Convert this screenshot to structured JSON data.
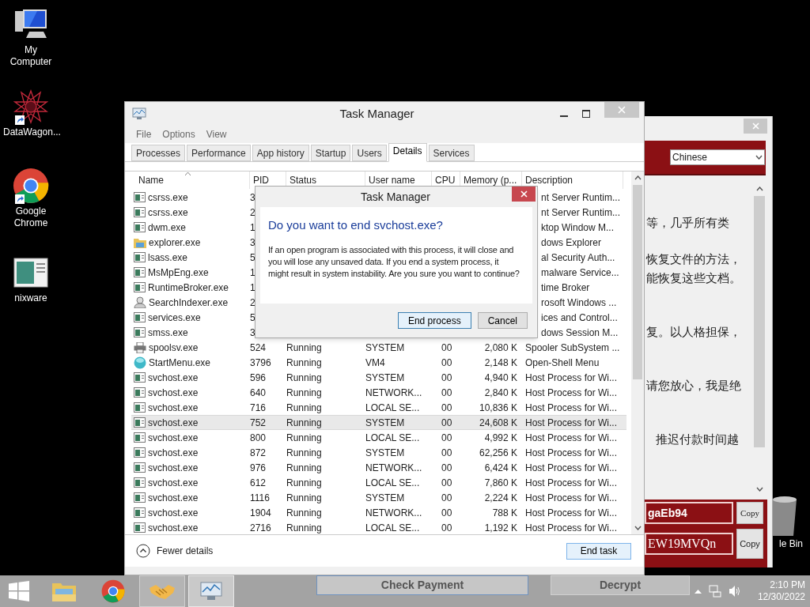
{
  "desktop_icons": [
    {
      "label": "My Computer",
      "kind": "computer",
      "shortcut": false
    },
    {
      "label": "DataWagon...",
      "kind": "star",
      "shortcut": true
    },
    {
      "label": "Google Chrome",
      "kind": "chrome",
      "shortcut": true
    },
    {
      "label": "nixware",
      "kind": "app",
      "shortcut": false
    }
  ],
  "recycle_bin": {
    "label": "le Bin"
  },
  "ransom_window": {
    "language_select": {
      "value": "Chinese"
    },
    "text_lines": [
      {
        "text": "等，几乎所有类",
        "kind": "section"
      },
      {
        "text": "恢复文件的方法，",
        "kind": "paragraph"
      },
      {
        "text": "能恢复这些文档。",
        "kind": "continuation"
      },
      {
        "text": "复。以人格担保，",
        "kind": "section"
      },
      {
        "text": "请您放心，我是绝",
        "kind": "section"
      },
      {
        "text": "推迟付款时间越",
        "kind": "indented"
      }
    ],
    "fields": [
      {
        "value": "gaEb94",
        "button": "Copy",
        "kind": "sans"
      },
      {
        "value": "EW19MVQn",
        "button": "Copy",
        "kind": "serif"
      }
    ],
    "buttons": [
      "Check Payment",
      "Decrypt"
    ]
  },
  "task_manager": {
    "title": "Task Manager",
    "menu": [
      "File",
      "Options",
      "View"
    ],
    "tabs": [
      {
        "label": "Processes",
        "selected": false
      },
      {
        "label": "Performance",
        "selected": false
      },
      {
        "label": "App history",
        "selected": false
      },
      {
        "label": "Startup",
        "selected": false
      },
      {
        "label": "Users",
        "selected": false
      },
      {
        "label": "Details",
        "selected": true
      },
      {
        "label": "Services",
        "selected": false
      }
    ],
    "columns": [
      "Name",
      "PID",
      "Status",
      "User name",
      "CPU",
      "Memory (p...",
      "Description"
    ],
    "rows": [
      {
        "name": "csrss.exe",
        "kind": "app",
        "pid": "3",
        "description": "nt Server Runtim...",
        "selected": false
      },
      {
        "name": "csrss.exe",
        "kind": "app",
        "pid": "2",
        "description": "nt Server Runtim...",
        "selected": false
      },
      {
        "name": "dwm.exe",
        "kind": "app",
        "pid": "1",
        "description": "ktop Window M...",
        "selected": false
      },
      {
        "name": "explorer.exe",
        "kind": "folder",
        "pid": "3",
        "description": "dows Explorer",
        "selected": false
      },
      {
        "name": "lsass.exe",
        "kind": "app",
        "pid": "5",
        "description": "al Security Auth...",
        "selected": false
      },
      {
        "name": "MsMpEng.exe",
        "kind": "app",
        "pid": "1",
        "description": "malware Service...",
        "selected": false
      },
      {
        "name": "RuntimeBroker.exe",
        "kind": "app",
        "pid": "1",
        "description": "time Broker",
        "selected": false
      },
      {
        "name": "SearchIndexer.exe",
        "kind": "user",
        "pid": "2",
        "description": "rosoft Windows ...",
        "selected": false
      },
      {
        "name": "services.exe",
        "kind": "app",
        "pid": "5",
        "description": "ices and Control...",
        "selected": false
      },
      {
        "name": "smss.exe",
        "kind": "app",
        "pid": "3",
        "description": "dows Session M...",
        "selected": false
      },
      {
        "name": "spoolsv.exe",
        "kind": "printer",
        "pid": "524",
        "status": "Running",
        "user": "SYSTEM",
        "cpu": "00",
        "memory": "2,080 K",
        "description": "Spooler SubSystem ...",
        "selected": false
      },
      {
        "name": "StartMenu.exe",
        "kind": "orb",
        "pid": "3796",
        "status": "Running",
        "user": "VM4",
        "cpu": "00",
        "memory": "2,148 K",
        "description": "Open-Shell Menu",
        "selected": false
      },
      {
        "name": "svchost.exe",
        "kind": "app",
        "pid": "596",
        "status": "Running",
        "user": "SYSTEM",
        "cpu": "00",
        "memory": "4,940 K",
        "description": "Host Process for Wi...",
        "selected": false
      },
      {
        "name": "svchost.exe",
        "kind": "app",
        "pid": "640",
        "status": "Running",
        "user": "NETWORK...",
        "cpu": "00",
        "memory": "2,840 K",
        "description": "Host Process for Wi...",
        "selected": false
      },
      {
        "name": "svchost.exe",
        "kind": "app",
        "pid": "716",
        "status": "Running",
        "user": "LOCAL SE...",
        "cpu": "00",
        "memory": "10,836 K",
        "description": "Host Process for Wi...",
        "selected": false
      },
      {
        "name": "svchost.exe",
        "kind": "app",
        "pid": "752",
        "status": "Running",
        "user": "SYSTEM",
        "cpu": "00",
        "memory": "24,608 K",
        "description": "Host Process for Wi...",
        "selected": true
      },
      {
        "name": "svchost.exe",
        "kind": "app",
        "pid": "800",
        "status": "Running",
        "user": "LOCAL SE...",
        "cpu": "00",
        "memory": "4,992 K",
        "description": "Host Process for Wi...",
        "selected": false
      },
      {
        "name": "svchost.exe",
        "kind": "app",
        "pid": "872",
        "status": "Running",
        "user": "SYSTEM",
        "cpu": "00",
        "memory": "62,256 K",
        "description": "Host Process for Wi...",
        "selected": false
      },
      {
        "name": "svchost.exe",
        "kind": "app",
        "pid": "976",
        "status": "Running",
        "user": "NETWORK...",
        "cpu": "00",
        "memory": "6,424 K",
        "description": "Host Process for Wi...",
        "selected": false
      },
      {
        "name": "svchost.exe",
        "kind": "app",
        "pid": "612",
        "status": "Running",
        "user": "LOCAL SE...",
        "cpu": "00",
        "memory": "7,860 K",
        "description": "Host Process for Wi...",
        "selected": false
      },
      {
        "name": "svchost.exe",
        "kind": "app",
        "pid": "1116",
        "status": "Running",
        "user": "SYSTEM",
        "cpu": "00",
        "memory": "2,224 K",
        "description": "Host Process for Wi...",
        "selected": false
      },
      {
        "name": "svchost.exe",
        "kind": "app",
        "pid": "1904",
        "status": "Running",
        "user": "NETWORK...",
        "cpu": "00",
        "memory": "788 K",
        "description": "Host Process for Wi...",
        "selected": false
      },
      {
        "name": "svchost.exe",
        "kind": "app",
        "pid": "2716",
        "status": "Running",
        "user": "LOCAL SE...",
        "cpu": "00",
        "memory": "1,192 K",
        "description": "Host Process for Wi...",
        "selected": false
      }
    ],
    "fewer_details": "Fewer details",
    "end_task": "End task"
  },
  "dialog": {
    "title": "Task Manager",
    "heading": "Do you want to end svchost.exe?",
    "body": "If an open program is associated with this process, it will close and you will lose any unsaved data. If you end a system process, it might result in system instability. Are you sure you want to continue?",
    "buttons": [
      {
        "label": "End process",
        "focused": true
      },
      {
        "label": "Cancel",
        "focused": false
      }
    ]
  },
  "taskbar": {
    "apps": [
      {
        "kind": "explorer",
        "open": false,
        "focused": false
      },
      {
        "kind": "chrome",
        "open": false,
        "focused": false
      },
      {
        "kind": "handshake",
        "open": true,
        "focused": false
      },
      {
        "kind": "taskmgr",
        "open": true,
        "focused": true
      }
    ],
    "time": "2:10 PM",
    "date": "12/30/2022"
  }
}
